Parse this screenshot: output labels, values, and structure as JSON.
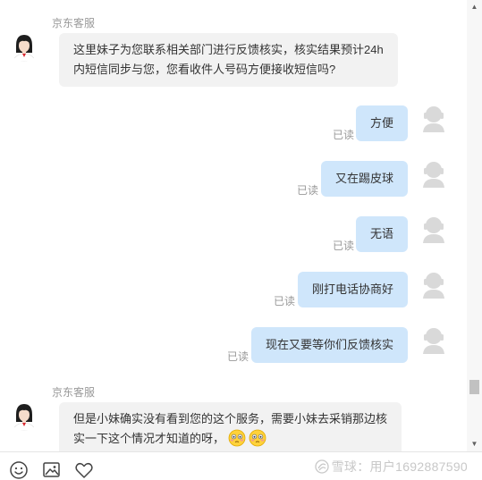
{
  "chat": {
    "messages": [
      {
        "sender": "agent",
        "name": "京东客服",
        "lines": [
          "这里妹子为您联系相关部门进行反馈核实，核实结果预计24h",
          "内短信同步与您，您看收件人号码方便接收短信吗?"
        ]
      },
      {
        "sender": "user",
        "text": "方便",
        "status": "已读"
      },
      {
        "sender": "user",
        "text": "又在踢皮球",
        "status": "已读"
      },
      {
        "sender": "user",
        "text": "无语",
        "status": "已读"
      },
      {
        "sender": "user",
        "text": "刚打电话协商好",
        "status": "已读"
      },
      {
        "sender": "user",
        "text": "现在又要等你们反馈核实",
        "status": "已读"
      },
      {
        "sender": "agent",
        "name": "京东客服",
        "lines": [
          "但是小妹确实没有看到您的这个服务，需要小妹去采销那边核",
          "实一下这个情况才知道的呀，"
        ],
        "emojis": [
          "flushed-face-emoji",
          "flushed-face-emoji"
        ]
      }
    ]
  },
  "toolbar": {
    "icons": [
      "smiley-icon",
      "image-icon",
      "heart-icon"
    ]
  },
  "watermark": {
    "brand": "雪球",
    "text": "：用户1692887590"
  },
  "colors": {
    "agent_bubble": "#f2f2f2",
    "user_bubble": "#cfe6fb",
    "meta_text": "#999999"
  }
}
